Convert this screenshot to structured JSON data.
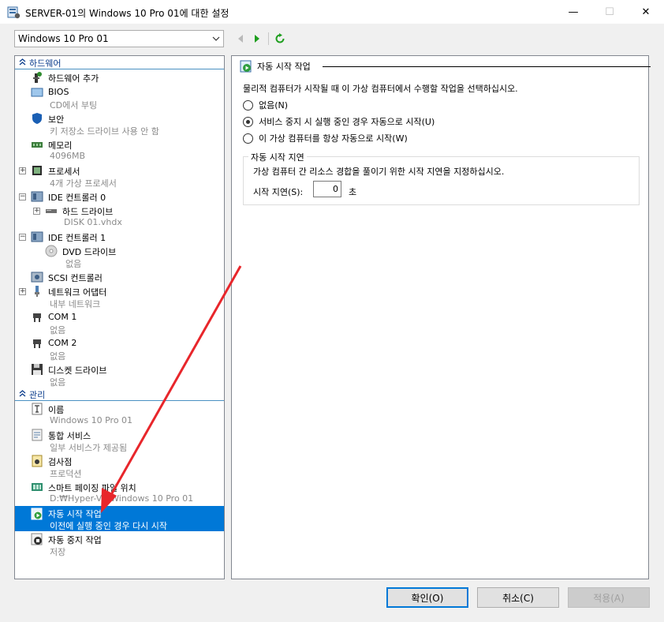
{
  "window": {
    "title": "SERVER-01의 Windows 10 Pro 01에 대한 설정",
    "minimize": "—",
    "maximize": "☐",
    "close": "✕"
  },
  "vm_select": {
    "value": "Windows 10 Pro 01"
  },
  "tree": {
    "hardware_section": "하드웨어",
    "management_section": "관리",
    "hardware_items": [
      {
        "label": "하드웨어 추가",
        "sub": ""
      },
      {
        "label": "BIOS",
        "sub": "CD에서 부팅"
      },
      {
        "label": "보안",
        "sub": "키 저장소 드라이브 사용 안 함"
      },
      {
        "label": "메모리",
        "sub": "4096MB"
      },
      {
        "label": "프로세서",
        "sub": "4개 가상 프로세서"
      },
      {
        "label": "IDE 컨트롤러 0",
        "sub": ""
      },
      {
        "label": "하드 드라이브",
        "sub": "DISK 01.vhdx"
      },
      {
        "label": "IDE 컨트롤러 1",
        "sub": ""
      },
      {
        "label": "DVD 드라이브",
        "sub": "없음"
      },
      {
        "label": "SCSI 컨트롤러",
        "sub": ""
      },
      {
        "label": "네트워크 어댑터",
        "sub": "내부 네트워크"
      },
      {
        "label": "COM 1",
        "sub": "없음"
      },
      {
        "label": "COM 2",
        "sub": "없음"
      },
      {
        "label": "디스켓 드라이브",
        "sub": "없음"
      }
    ],
    "management_items": [
      {
        "label": "이름",
        "sub": "Windows 10 Pro 01"
      },
      {
        "label": "통합 서비스",
        "sub": "일부 서비스가 제공됨"
      },
      {
        "label": "검사점",
        "sub": "프로덕션"
      },
      {
        "label": "스마트 페이징 파일 위치",
        "sub": "D:₩Hyper-V₩Windows 10 Pro 01"
      },
      {
        "label": "자동 시작 작업",
        "sub": "이전에 실행 중인 경우 다시 시작"
      },
      {
        "label": "자동 중지 작업",
        "sub": "저장"
      }
    ]
  },
  "panel": {
    "header": "자동 시작 작업",
    "description": "물리적 컴퓨터가 시작될 때 이 가상 컴퓨터에서 수행할 작업을 선택하십시오.",
    "options": [
      {
        "label": "없음(N)",
        "checked": false
      },
      {
        "label": "서비스 중지 시 실행 중인 경우 자동으로 시작(U)",
        "checked": true
      },
      {
        "label": "이 가상 컴퓨터를 항상 자동으로 시작(W)",
        "checked": false
      }
    ],
    "delay_group_title": "자동 시작 지연",
    "delay_description": "가상 컴퓨터 간 리소스 경합을 풀이기 위한 시작 지연을 지정하십시오.",
    "delay_label": "시작 지연(S):",
    "delay_value": "0",
    "delay_unit": "초"
  },
  "buttons": {
    "ok": "확인(O)",
    "cancel": "취소(C)",
    "apply": "적용(A)"
  },
  "colors": {
    "selection": "#0078d7",
    "annotation_arrow": "#e8262b",
    "section_header": "#0c3d8c"
  }
}
